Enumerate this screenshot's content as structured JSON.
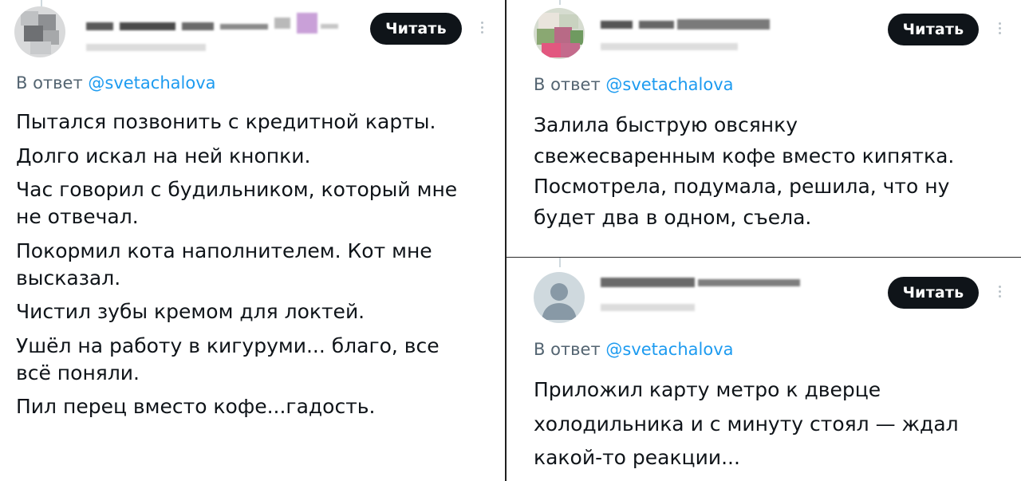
{
  "reply_prefix": "В ответ",
  "reply_handle": "@svetachalova",
  "read_label": "Читать",
  "icons": {
    "more": "more-vertical-icon",
    "avatar_default": "default-avatar-icon"
  },
  "colors": {
    "link": "#1d9bf0",
    "button": "#0f1419",
    "muted": "#536471"
  },
  "posts": [
    {
      "lines": [
        "Пытался позвонить с кредитной карты.",
        "Долго искал на ней кнопки.",
        "Час говорил с будильником, который мне",
        "не отвечал.",
        "Покормил кота наполнителем. Кот мне",
        "высказал.",
        "Чистил зубы кремом для локтей.",
        "Ушёл на работу в кигуруми... благо, все",
        "всё поняли.",
        "Пил перец вместо кофе...гадость."
      ]
    },
    {
      "lines": [
        "Залила быструю овсянку",
        "свежесваренным кофе вместо кипятка.",
        "Посмотрела, подумала, решила, что ну",
        "будет два в одном, съела."
      ]
    },
    {
      "lines": [
        "Приложил карту метро к дверце",
        "холодильника и с минуту стоял — ждал",
        "какой-то реакции..."
      ]
    }
  ]
}
